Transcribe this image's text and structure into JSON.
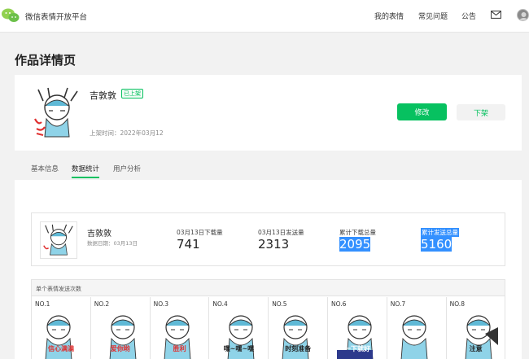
{
  "brand": "微信表情开放平台",
  "nav": {
    "my_stickers": "我的表情",
    "faq": "常见问题",
    "notice": "公告"
  },
  "page_title": "作品详情页",
  "work": {
    "name": "吉敦敦",
    "status": "已上架",
    "meta": "上架时间：2022年03月12",
    "edit_label": "修改",
    "off_label": "下架"
  },
  "tabs": [
    "基本信息",
    "数据统计",
    "用户分析"
  ],
  "summary": {
    "name": "吉敦敦",
    "date": "数据日期：03月13日",
    "stats": [
      {
        "label": "03月13日下载量",
        "value": "741"
      },
      {
        "label": "03月13日发送量",
        "value": "2313"
      },
      {
        "label": "累计下载总量",
        "value": "2095"
      },
      {
        "label": "累计发送总量",
        "value": "5160"
      }
    ]
  },
  "per_sticker": {
    "title": "单个表情发送次数",
    "items": [
      {
        "no": "NO.1",
        "caption": "信心满满"
      },
      {
        "no": "NO.2",
        "caption": "爱你哟"
      },
      {
        "no": "NO.3",
        "caption": "胜利"
      },
      {
        "no": "NO.4",
        "caption": "嘿~嘿~嘿"
      },
      {
        "no": "NO.5",
        "caption": "时刻准备"
      },
      {
        "no": "NO.6",
        "caption": "一下就好"
      },
      {
        "no": "NO.7",
        "caption": ""
      },
      {
        "no": "NO.8",
        "caption": "注意"
      }
    ]
  },
  "colors": {
    "accent": "#07c160",
    "highlight": "#3390ff"
  }
}
